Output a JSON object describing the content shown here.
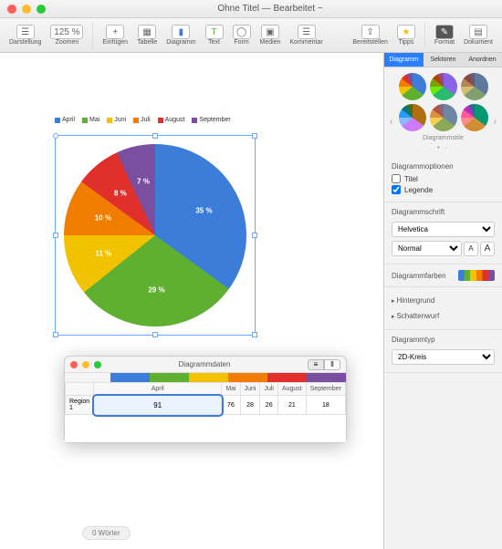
{
  "window": {
    "title": "Ohne Titel — Bearbeitet ~"
  },
  "toolbar": {
    "view_label": "Darstellung",
    "zoom_value": "125 %",
    "zoom_label": "Zoomen",
    "insert_label": "Einfügen",
    "table_label": "Tabelle",
    "chart_label": "Diagramm",
    "text_label": "Text",
    "shape_label": "Form",
    "media_label": "Medien",
    "comment_label": "Kommentar",
    "share_label": "Bereitstellen",
    "tips_label": "Tipps",
    "format_label": "Format",
    "document_label": "Dokument"
  },
  "inspector": {
    "tabs": [
      "Diagramm",
      "Sektoren",
      "Anordnen"
    ],
    "style_label": "Diagrammstile",
    "options_header": "Diagrammoptionen",
    "title_checkbox": "Titel",
    "legend_checkbox": "Legende",
    "font_header": "Diagrammschrift",
    "font_family": "Helvetica",
    "font_style": "Normal",
    "colors_header": "Diagrammfarben",
    "bg_header": "Hintergrund",
    "shadow_header": "Schattenwurf",
    "type_header": "Diagrammtyp",
    "type_value": "2D-Kreis"
  },
  "chart_data": {
    "type": "pie",
    "categories": [
      "April",
      "Mai",
      "Juni",
      "Juli",
      "August",
      "September"
    ],
    "values": [
      91,
      76,
      28,
      26,
      21,
      18
    ],
    "percent_labels": [
      "35 %",
      "29 %",
      "11 %",
      "10 %",
      "8 %",
      "7 %"
    ],
    "colors": [
      "#3b7dd8",
      "#5fb030",
      "#f2c100",
      "#f07c00",
      "#e12f2c",
      "#7b4fa0"
    ],
    "row_label": "Region 1",
    "selected_cell_index": 0
  },
  "data_window": {
    "title": "Diagrammdaten"
  },
  "footer": {
    "word_count": "0 Wörter"
  }
}
